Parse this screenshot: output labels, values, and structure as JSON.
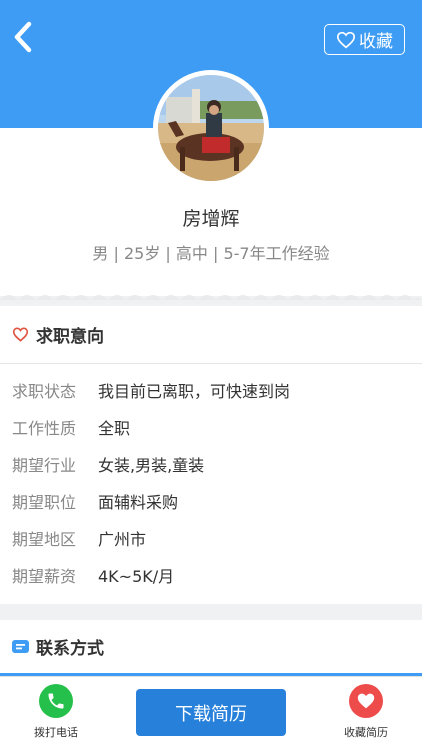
{
  "header": {
    "favorite_label": "收藏",
    "accent_color": "#3e9cf4"
  },
  "profile": {
    "name": "房增辉",
    "meta": "男 | 25岁 | 高中 | 5-7年工作经验"
  },
  "intent": {
    "title": "求职意向",
    "rows": [
      {
        "label": "求职状态",
        "value": "我目前已离职，可快速到岗"
      },
      {
        "label": "工作性质",
        "value": "全职"
      },
      {
        "label": "期望行业",
        "value": "女装,男装,童装"
      },
      {
        "label": "期望职位",
        "value": "面辅料采购"
      },
      {
        "label": "期望地区",
        "value": "广州市"
      },
      {
        "label": "期望薪资",
        "value": "4K~5K/月"
      }
    ]
  },
  "contact": {
    "title": "联系方式"
  },
  "bottom": {
    "call_label": "拨打电话",
    "download_label": "下载简历",
    "collect_label": "收藏简历"
  }
}
